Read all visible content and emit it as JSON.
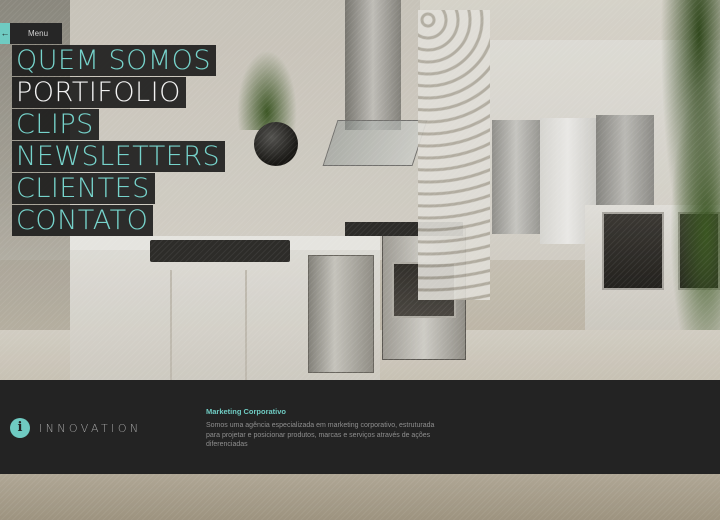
{
  "menu_toggle": {
    "label": "Menu",
    "accent_glyph": "←"
  },
  "nav": {
    "items": [
      {
        "label": "QUEM SOMOS",
        "active": false
      },
      {
        "label": "PORTIFOLIO",
        "active": true
      },
      {
        "label": "CLIPS",
        "active": false
      },
      {
        "label": "NEWSLETTERS",
        "active": false
      },
      {
        "label": "CLIENTES",
        "active": false
      },
      {
        "label": "CONTATO",
        "active": false
      }
    ]
  },
  "brand": {
    "icon_glyph": "i",
    "icon_name": "info-icon",
    "name": "INNOVATION"
  },
  "info": {
    "title": "Marketing Corporativo",
    "description": "Somos uma agência especializada em marketing corporativo, estruturada para projetar e posicionar produtos, marcas e serviços através de ações diferenciadas"
  },
  "colors": {
    "accent": "#6fcbc2",
    "nav_bg": "#161616",
    "band_bg": "#232323",
    "nav_active": "#f2f2f2"
  }
}
